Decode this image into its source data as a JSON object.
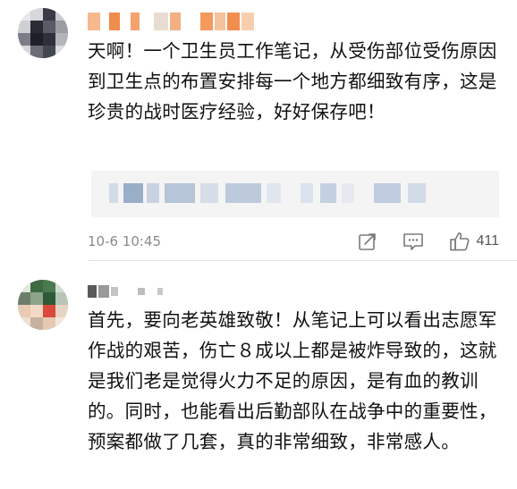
{
  "comments": [
    {
      "text": "天啊！一个卫生员工作笔记，从受伤部位受伤原因到卫生点的布置安排每一个地方都细致有序，这是珍贵的战时医疗经验，好好保存吧！",
      "timestamp": "10-6 10:45",
      "likes": "411",
      "icons": {
        "share": "share-icon",
        "reply": "comment-icon",
        "like": "thumbs-up-icon"
      }
    },
    {
      "text": "首先，要向老英雄致敬！从笔记上可以看出志愿军作战的艰苦，伤亡８成以上都是被炸导致的，这就是我们老是觉得火力不足的原因，是有血的教训的。同时，也能看出后勤部队在战争中的重要性，预案都做了几套，真的非常细致，非常感人。"
    }
  ],
  "colors": {
    "meta_text": "#8a8a8a",
    "divider": "#e4e4e4",
    "quote_bg": "#f4f4f4"
  }
}
